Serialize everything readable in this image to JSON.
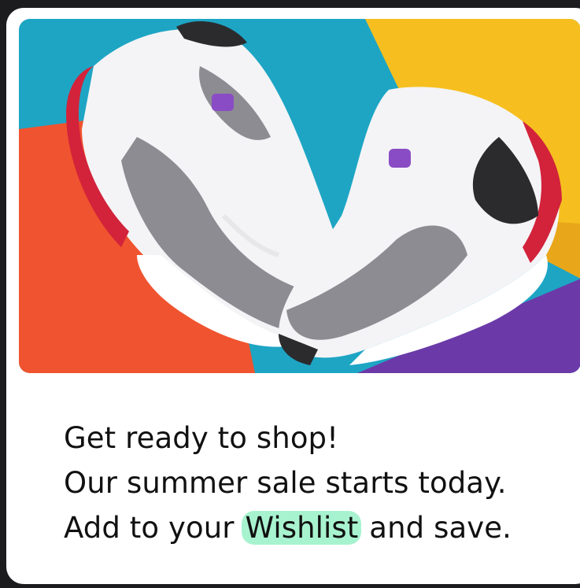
{
  "promo": {
    "line1": "Get ready to shop!",
    "line2": "Our summer sale starts today.",
    "line3_before": "Add to your",
    "line3_highlight": "Wishlist",
    "line3_after": "and save.",
    "highlight_color": "#a8f3cf"
  },
  "hero": {
    "icon": "sneakers-photo",
    "colors": {
      "teal": "#1ea5c4",
      "yellow": "#f6bf1f",
      "orange": "#f0532f",
      "purple": "#6b3aa8"
    }
  }
}
